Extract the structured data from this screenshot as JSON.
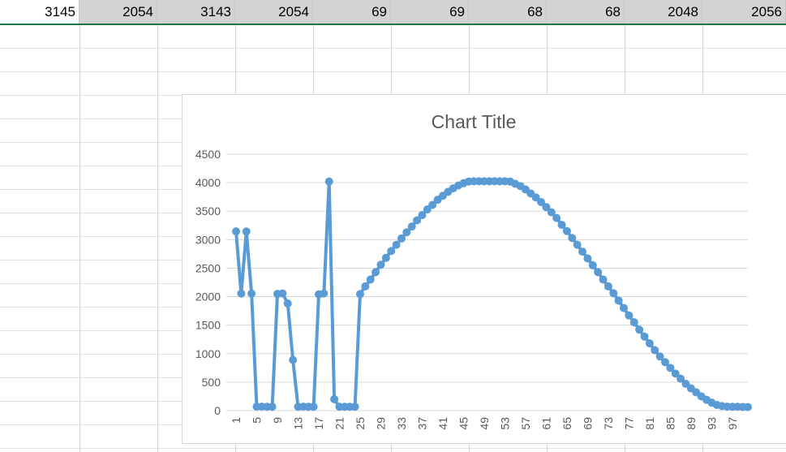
{
  "spreadsheet": {
    "row1_cells": [
      {
        "value": "3145",
        "selected": true
      },
      {
        "value": "2054",
        "selected": false
      },
      {
        "value": "3143",
        "selected": false
      },
      {
        "value": "2054",
        "selected": false
      },
      {
        "value": "69",
        "selected": false
      },
      {
        "value": "69",
        "selected": false
      },
      {
        "value": "68",
        "selected": false
      },
      {
        "value": "68",
        "selected": false
      },
      {
        "value": "2048",
        "selected": false
      },
      {
        "value": "2056",
        "selected": false
      }
    ],
    "selection_color": "#217346",
    "highlight_color": "#d3d3d3"
  },
  "chart_data": {
    "type": "line",
    "title": "Chart Title",
    "xlabel": "",
    "ylabel": "",
    "ylim": [
      0,
      4500
    ],
    "yticks": [
      0,
      500,
      1000,
      1500,
      2000,
      2500,
      3000,
      3500,
      4000,
      4500
    ],
    "xticks": [
      "1",
      "5",
      "9",
      "13",
      "17",
      "21",
      "25",
      "29",
      "33",
      "37",
      "41",
      "45",
      "49",
      "53",
      "57",
      "61",
      "65",
      "69",
      "73",
      "77",
      "81",
      "85",
      "89",
      "93",
      "97"
    ],
    "grid": true,
    "legend": "none",
    "series_color": "#5b9bd5",
    "x": [
      1,
      2,
      3,
      4,
      5,
      6,
      7,
      8,
      9,
      10,
      11,
      12,
      13,
      14,
      15,
      16,
      17,
      18,
      19,
      20,
      21,
      22,
      23,
      24,
      25,
      26,
      27,
      28,
      29,
      30,
      31,
      32,
      33,
      34,
      35,
      36,
      37,
      38,
      39,
      40,
      41,
      42,
      43,
      44,
      45,
      46,
      47,
      48,
      49,
      50,
      51,
      52,
      53,
      54,
      55,
      56,
      57,
      58,
      59,
      60,
      61,
      62,
      63,
      64,
      65,
      66,
      67,
      68,
      69,
      70,
      71,
      72,
      73,
      74,
      75,
      76,
      77,
      78,
      79,
      80,
      81,
      82,
      83,
      84,
      85,
      86,
      87,
      88,
      89,
      90,
      91,
      92,
      93,
      94,
      95,
      96,
      97,
      98,
      99,
      100
    ],
    "series": [
      {
        "values": [
          3145,
          2054,
          3143,
          2054,
          69,
          69,
          68,
          68,
          2048,
          2056,
          1880,
          890,
          68,
          69,
          68,
          68,
          2040,
          2056,
          4020,
          200,
          68,
          68,
          68,
          68,
          2045,
          2180,
          2300,
          2430,
          2560,
          2680,
          2800,
          2910,
          3020,
          3130,
          3230,
          3340,
          3430,
          3530,
          3610,
          3700,
          3770,
          3840,
          3900,
          3950,
          3990,
          4020,
          4025,
          4025,
          4025,
          4025,
          4025,
          4025,
          4025,
          4020,
          3980,
          3940,
          3880,
          3810,
          3740,
          3660,
          3570,
          3480,
          3380,
          3260,
          3150,
          3030,
          2910,
          2790,
          2670,
          2550,
          2430,
          2300,
          2180,
          2060,
          1930,
          1800,
          1670,
          1550,
          1420,
          1300,
          1180,
          1060,
          950,
          850,
          750,
          650,
          560,
          470,
          390,
          320,
          250,
          190,
          140,
          100,
          80,
          70,
          68,
          68,
          65,
          63
        ]
      }
    ]
  }
}
